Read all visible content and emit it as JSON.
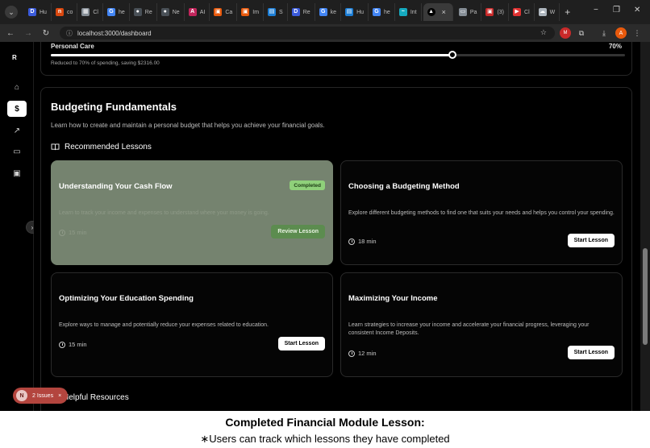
{
  "browser": {
    "tabs": [
      {
        "icon": "D",
        "label": "Hu",
        "color": "#3b5bdb"
      },
      {
        "icon": "n",
        "label": "co",
        "color": "#d9480f"
      },
      {
        "icon": "▦",
        "label": "Cl",
        "color": "#868e96"
      },
      {
        "icon": "G",
        "label": "he",
        "color": "#4285f4"
      },
      {
        "icon": "●",
        "label": "Re",
        "color": "#495057"
      },
      {
        "icon": "●",
        "label": "Ne",
        "color": "#495057"
      },
      {
        "icon": "A",
        "label": "AI",
        "color": "#c2255c"
      },
      {
        "icon": "▣",
        "label": "Ca",
        "color": "#e8590c"
      },
      {
        "icon": "▣",
        "label": "Im",
        "color": "#e8590c"
      },
      {
        "icon": "▤",
        "label": "S",
        "color": "#1c7ed6"
      },
      {
        "icon": "D",
        "label": "Re",
        "color": "#3b5bdb"
      },
      {
        "icon": "G",
        "label": "ke",
        "color": "#4285f4"
      },
      {
        "icon": "▤",
        "label": "Hu",
        "color": "#1c7ed6"
      },
      {
        "icon": "G",
        "label": "he",
        "color": "#4285f4"
      },
      {
        "icon": "~",
        "label": "Int",
        "color": "#15aabf"
      }
    ],
    "active_tab_icon": "▲",
    "more_tabs": [
      {
        "icon": "▭",
        "label": "Pa",
        "color": "#868e96"
      },
      {
        "icon": "▣",
        "label": "(3)",
        "color": "#c92a2a"
      },
      {
        "icon": "▶",
        "label": "Cl",
        "color": "#e03131"
      },
      {
        "icon": "☁",
        "label": "W",
        "color": "#adb5bd"
      }
    ],
    "url": "localhost:3000/dashboard",
    "profile_initial": "A"
  },
  "sidebar": {
    "logo": "R",
    "items": [
      {
        "icon": "⌂"
      },
      {
        "icon": "$"
      },
      {
        "icon": "↗"
      },
      {
        "icon": "▭"
      },
      {
        "icon": "▣"
      }
    ]
  },
  "top_card": {
    "category": "Personal Care",
    "percent": "70%",
    "slider_value": 70,
    "note": "Reduced to 70% of spending, saving $2316.00"
  },
  "module": {
    "title": "Budgeting Fundamentals",
    "description": "Learn how to create and maintain a personal budget that helps you achieve your financial goals.",
    "lessons_heading": "Recommended Lessons",
    "lessons": [
      {
        "title": "Understanding Your Cash Flow",
        "description": "Learn to track your income and expenses to understand where your money is going.",
        "duration": "15 min",
        "badge": "Completed",
        "button": "Review Lesson"
      },
      {
        "title": "Choosing a Budgeting Method",
        "description": "Explore different budgeting methods to find one that suits your needs and helps you control your spending.",
        "duration": "18 min",
        "button": "Start Lesson"
      },
      {
        "title": "Optimizing Your Education Spending",
        "description": "Explore ways to manage and potentially reduce your expenses related to education.",
        "duration": "15 min",
        "button": "Start Lesson"
      },
      {
        "title": "Maximizing Your Income",
        "description": "Learn strategies to increase your income and accelerate your financial progress, leveraging your consistent Income Deposits.",
        "duration": "12 min",
        "button": "Start Lesson"
      }
    ],
    "resources_heading": "Helpful Resources"
  },
  "issues_badge": {
    "logo": "N",
    "label": "2 Issues",
    "close": "×"
  },
  "caption": {
    "title": "Completed Financial Module Lesson:",
    "subtitle": "∗Users can track which lessons they have completed"
  }
}
